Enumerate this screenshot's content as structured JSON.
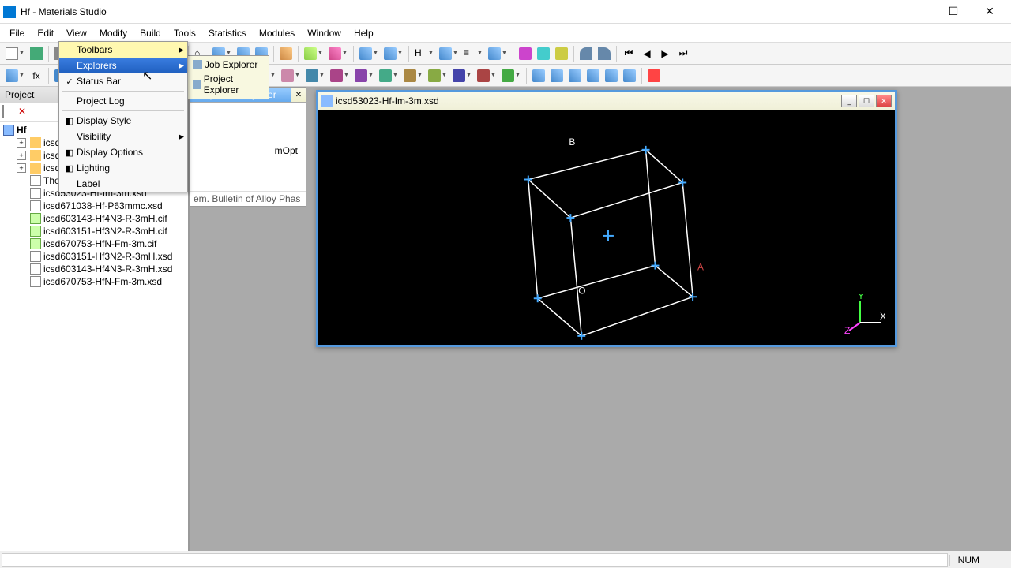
{
  "titlebar": {
    "title": "Hf - Materials Studio"
  },
  "menubar": [
    "File",
    "Edit",
    "View",
    "Modify",
    "Build",
    "Tools",
    "Statistics",
    "Modules",
    "Window",
    "Help"
  ],
  "project": {
    "header": "Project",
    "root": "Hf",
    "items": [
      {
        "label": "icsd",
        "icon": "folder",
        "expand": true
      },
      {
        "label": "icsd",
        "icon": "folder",
        "expand": true
      },
      {
        "label": "icsd",
        "icon": "folder",
        "expand": true
      },
      {
        "label": "The",
        "icon": "doc"
      },
      {
        "label": "icsd53023-Hf-Im-3m.xsd",
        "icon": "doc"
      },
      {
        "label": "icsd671038-Hf-P63mmc.xsd",
        "icon": "doc"
      },
      {
        "label": "icsd603143-Hf4N3-R-3mH.cif",
        "icon": "cif"
      },
      {
        "label": "icsd603151-Hf3N2-R-3mH.cif",
        "icon": "cif"
      },
      {
        "label": "icsd670753-HfN-Fm-3m.cif",
        "icon": "cif"
      },
      {
        "label": "icsd603151-Hf3N2-R-3mH.xsd",
        "icon": "doc"
      },
      {
        "label": "icsd603143-Hf4N3-R-3mH.xsd",
        "icon": "doc"
      },
      {
        "label": "icsd670753-HfN-Fm-3m.xsd",
        "icon": "doc"
      }
    ]
  },
  "view_menu": {
    "items": [
      {
        "label": "Toolbars",
        "arrow": true
      },
      {
        "label": "Explorers",
        "arrow": true,
        "highlighted": true
      },
      {
        "label": "Status Bar",
        "checked": true
      },
      {
        "sep": true
      },
      {
        "label": "Project Log"
      },
      {
        "sep": true
      },
      {
        "label": "Display Style",
        "icon": true
      },
      {
        "label": "Visibility",
        "arrow": true
      },
      {
        "label": "Display Options",
        "icon": true
      },
      {
        "label": "Lighting",
        "icon": true
      },
      {
        "label": "Label"
      }
    ]
  },
  "sub_flyout": {
    "items": [
      {
        "label": "Job Explorer"
      },
      {
        "label": "Project Explorer"
      }
    ]
  },
  "properties_panel": {
    "title": "Properties Explorer",
    "mopt": "mOpt",
    "bottom": "em. Bulletin of Alloy Phas"
  },
  "doc_window": {
    "title": "icsd53023-Hf-Im-3m.xsd"
  },
  "viewport": {
    "labels": {
      "B": "B",
      "O": "O",
      "A": "A",
      "X": "X",
      "Y": "Y",
      "Z": "Z"
    },
    "center_marker": "+"
  },
  "statusbar": {
    "num": "NUM"
  }
}
